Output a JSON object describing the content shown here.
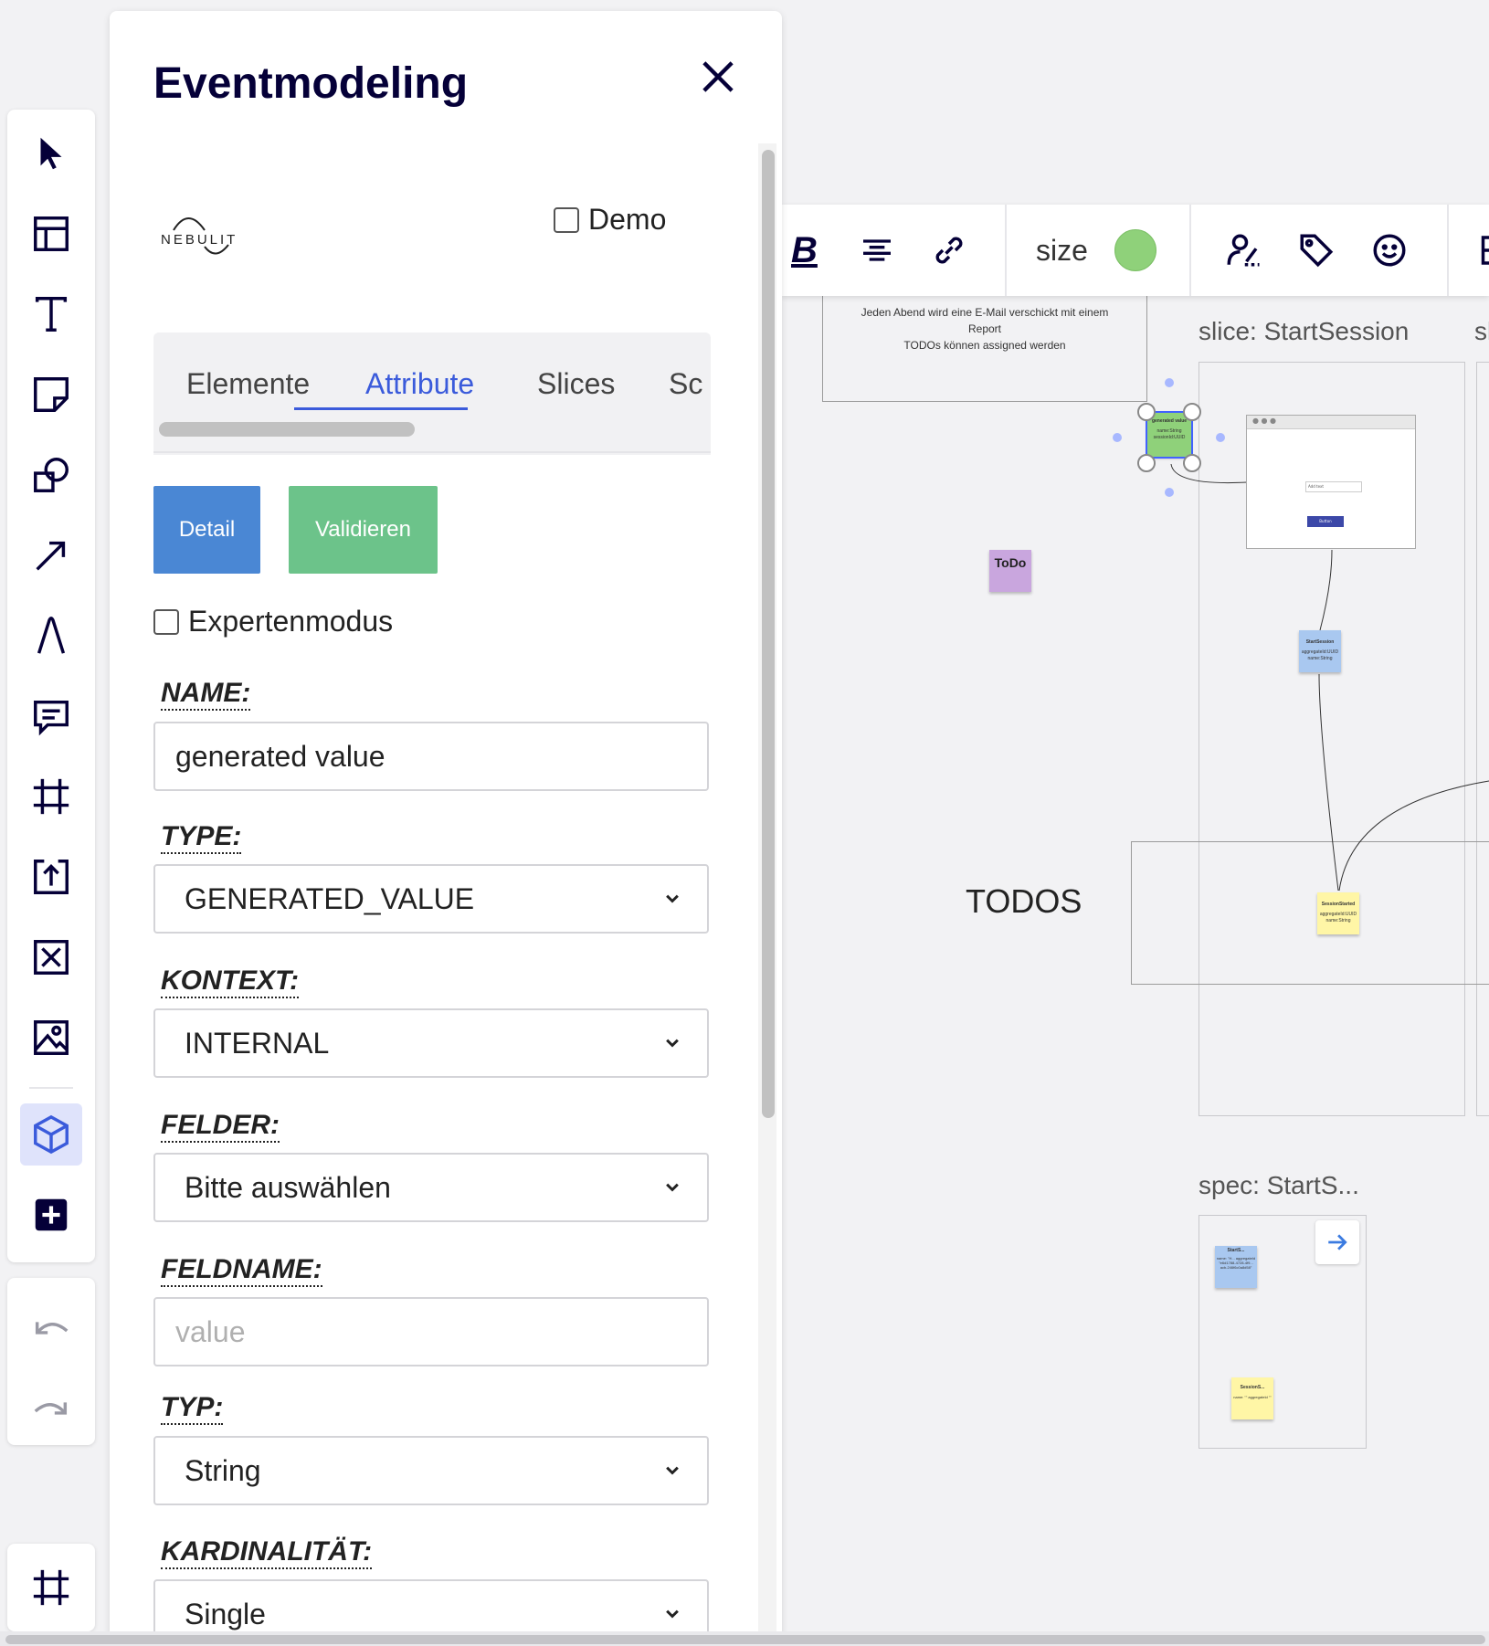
{
  "panel": {
    "title": "Eventmodeling",
    "logo_text": "NEBULIT",
    "demo_label": "Demo",
    "tabs": [
      "Elemente",
      "Attribute",
      "Slices",
      "Sc"
    ],
    "buttons": {
      "detail": "Detail",
      "validate": "Validieren"
    },
    "expert_mode_label": "Expertenmodus",
    "fields": {
      "name_label": "NAME:",
      "name_value": "generated value",
      "type_label": "TYPE:",
      "type_value": "GENERATED_VALUE",
      "context_label": "KONTEXT:",
      "context_value": "INTERNAL",
      "fields_label": "FELDER:",
      "fields_value": "Bitte auswählen",
      "fieldname_label": "FELDNAME:",
      "fieldname_placeholder": "value",
      "typ_label": "TYP:",
      "typ_value": "String",
      "cardinality_label": "KARDINALITÄT:",
      "cardinality_value": "Single"
    }
  },
  "context_toolbar": {
    "bold_label": "B",
    "size_label": "size",
    "color": "#8fd17a"
  },
  "canvas": {
    "description_line1": "Jeden Abend wird eine E-Mail verschickt mit einem",
    "description_line2": "Report",
    "description_line3": "TODOs können assigned werden",
    "slice_title": "slice: StartSession",
    "slice_title_cut": "sl",
    "todo_sticky": "ToDo",
    "todos_label": "TODOS",
    "spec_title": "spec: StartS...",
    "generated_sticky_title": "generated value",
    "generated_sticky_body": "name:String sessionId:UUID",
    "mockup_field": "Add text",
    "mockup_button": "Button",
    "command_sticky_title": "StartSession",
    "command_sticky_body": "aggregateId:UUID name:String",
    "event_sticky_title": "SessionStarted",
    "event_sticky_body": "aggregateId:UUID name:String",
    "spec_sticky1_title": "StartS...",
    "spec_sticky1_body": "name: \"H... aggregateId \"e6d1788-4728-4f9... acb-246f6c0a8d58\"",
    "spec_sticky2_title": "SessionS...",
    "spec_sticky2_body": "name: \"\" aggregateId \"\""
  },
  "colors": {
    "accent": "#3b5bdb",
    "detail_button": "#4a87d4",
    "validate_button": "#6cc38a",
    "sticky_green": "#8fd17a",
    "sticky_blue": "#a9c8f0",
    "sticky_yellow": "#fff6a6",
    "sticky_purple": "#c9a6de"
  }
}
